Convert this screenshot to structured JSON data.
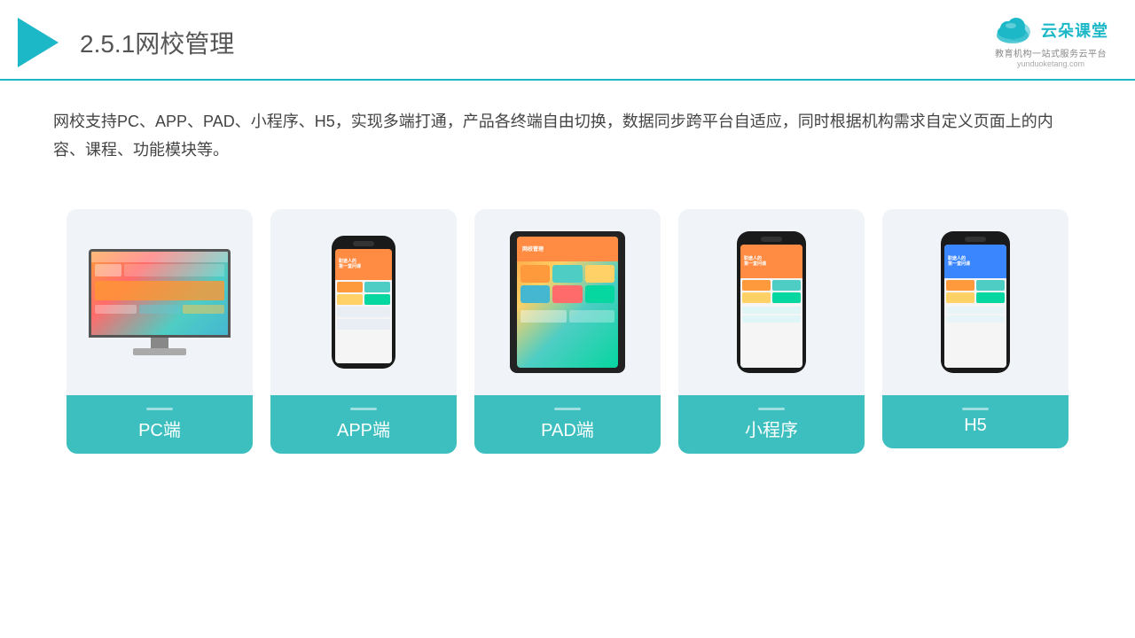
{
  "header": {
    "title_prefix": "2.5.1",
    "title_main": "网校管理",
    "logo_main": "云朵课堂",
    "logo_sub": "教育机构一站\n式服务云平台",
    "logo_url": "yunduoketang.com"
  },
  "description": {
    "text": "网校支持PC、APP、PAD、小程序、H5，实现多端打通，产品各终端自由切换，数据同步跨平台自适应，同时根据机构需求自定义页面上的内容、课程、功能模块等。"
  },
  "cards": [
    {
      "id": "pc",
      "label": "PC端"
    },
    {
      "id": "app",
      "label": "APP端"
    },
    {
      "id": "pad",
      "label": "PAD端"
    },
    {
      "id": "miniapp",
      "label": "小程序"
    },
    {
      "id": "h5",
      "label": "H5"
    }
  ],
  "colors": {
    "accent": "#1cb8c8",
    "card_label_bg": "#3ebfbf",
    "card_bg": "#f0f4f9"
  }
}
